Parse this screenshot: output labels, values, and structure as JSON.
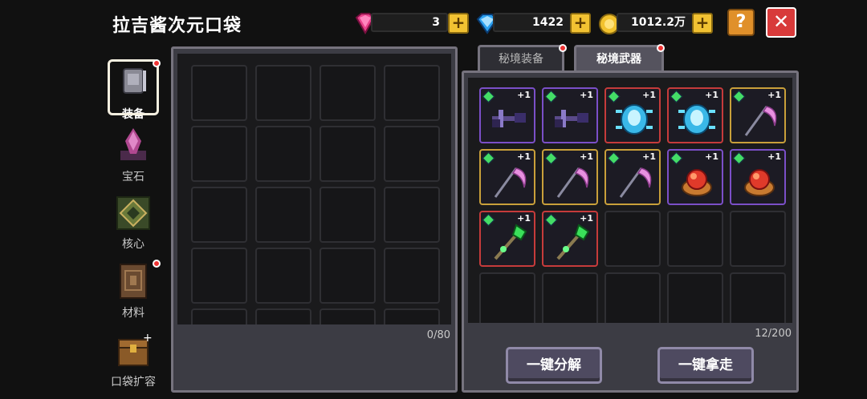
{
  "header": {
    "title": "拉吉酱次元口袋",
    "gems_pink": "3",
    "gems_blue": "1422",
    "gold": "1012.2万",
    "help_label": "?",
    "close_label": "✕"
  },
  "sidebar": {
    "items": [
      {
        "label": "装备",
        "icon": "armor-icon",
        "active": true,
        "dot": true
      },
      {
        "label": "宝石",
        "icon": "gem-crystal-icon",
        "active": false,
        "dot": false
      },
      {
        "label": "核心",
        "icon": "core-icon",
        "active": false,
        "dot": false
      },
      {
        "label": "材料",
        "icon": "book-icon",
        "active": false,
        "dot": true
      },
      {
        "label": "口袋扩容",
        "icon": "chest-icon",
        "active": false,
        "dot": false
      }
    ]
  },
  "left_panel": {
    "count": "0/80"
  },
  "right_panel": {
    "tabs": [
      {
        "label": "秘境装备",
        "active": false,
        "dot": true
      },
      {
        "label": "秘境武器",
        "active": true,
        "dot": true
      }
    ],
    "count": "12/200",
    "items": [
      {
        "name": "crossbow-weapon",
        "rarity": "purple",
        "level": "+1"
      },
      {
        "name": "crossbow-weapon",
        "rarity": "purple",
        "level": "+1"
      },
      {
        "name": "crystal-spider-weapon",
        "rarity": "red",
        "level": "+1"
      },
      {
        "name": "crystal-spider-weapon",
        "rarity": "red",
        "level": "+1"
      },
      {
        "name": "scythe-weapon",
        "rarity": "gold",
        "level": "+1"
      },
      {
        "name": "scythe-weapon",
        "rarity": "gold",
        "level": "+1"
      },
      {
        "name": "scythe-weapon",
        "rarity": "gold",
        "level": "+1"
      },
      {
        "name": "scythe-weapon",
        "rarity": "gold",
        "level": "+1"
      },
      {
        "name": "fire-orb-weapon",
        "rarity": "purple",
        "level": "+1"
      },
      {
        "name": "fire-orb-weapon",
        "rarity": "purple",
        "level": "+1"
      },
      {
        "name": "green-staff-weapon",
        "rarity": "red",
        "level": "+1"
      },
      {
        "name": "green-staff-weapon",
        "rarity": "red",
        "level": "+1"
      }
    ],
    "decompose_label": "一键分解",
    "take_all_label": "一键拿走"
  }
}
